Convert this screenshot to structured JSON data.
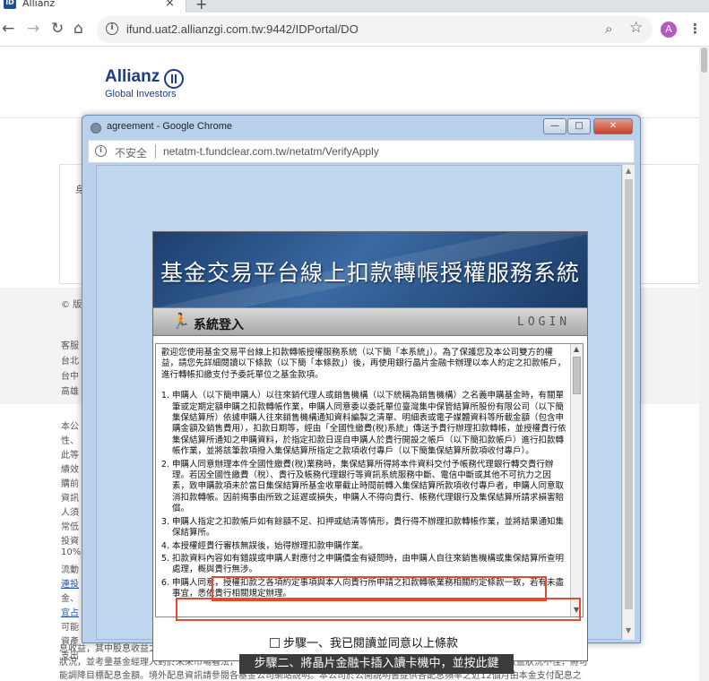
{
  "browser": {
    "tab_title": "Allianz",
    "tab_favicon": "ID",
    "address": "ifund.uat2.allianzgi.com.tw:9442/IDPortal/DO",
    "profile_initial": "A"
  },
  "page": {
    "logo_word": "Allianz",
    "logo_sub": "Global Investors",
    "fragments": [
      "身",
      "© 版",
      "客服",
      "台北",
      "台中",
      "高雄",
      "本公",
      "性、",
      "此等",
      "績效",
      "購前",
      "資訊",
      "人須",
      "常低",
      "投資",
      "10%",
      "流動",
      "金、",
      "可能",
      "資產",
      "支出"
    ],
    "links": [
      "連投",
      "宜占"
    ],
    "footnote_lines": [
      "息收益，其中股息收益之概況可由基金年化股息率而得；基金每月配息金額之決定，由境外基金機構根據已取得之資本利得及股息收益",
      "狀況，並考量基金經理人對於未來市場看法，評估預定之目標配息金額。若本基金因市場因素造成資本利得及股息收益狀況不佳，將可",
      "能調降目標配息金額。境外配息資訊請參閱各基金公司網站說明。本公司於公開說明書提供各配息頻率之近12個月由本金支付配息之"
    ]
  },
  "popup": {
    "window_title": "agreement - Google Chrome",
    "insecure_label": "不安全",
    "url": "netatm-t.fundclear.com.tw/netatm/VerifyApply",
    "banner_title": "基金交易平台線上扣款轉帳授權服務系統",
    "login_label": "系統登入",
    "login_en": "LOGIN",
    "terms_intro": "歡迎您使用基金交易平台線上扣款轉帳授權服務系統（以下簡「本系統」）。為了保護您及本公司雙方的權益，請您先詳細閱讀以下條款（以下簡「本條款」）後，再使用銀行晶片金融卡辦理以本人約定之扣款帳戶，進行轉帳扣繳支付予委託單位之基金款項。",
    "terms_items": [
      "申購人（以下簡申購人）以往來銷代理人或銷售機構（以下統稱為銷售機構）之名義申購基金時，有關單筆或定期定額申購之扣款轉帳作業，申購人同意委以委託單位臺灣集中保管結算所股份有限公司（以下簡集保結算所）依據申購人往來銷售機構通知資料編製之清單、明細表或電子媒體資料等所載金額（包含申購金額及銷售費用），扣款日期等，經由「全國性繳費(稅)系統」傳送予貴行辦理扣款轉帳，並授權貴行依集保結算所通知之申購資料，於指定扣款日逕自申購人於貴行開設之帳戶（以下簡扣款帳戶）進行扣款轉帳作業，並將該筆款項撥入集保結算所指定之款項收付專戶（以下簡集保結算所款項收付專戶）。",
      "申購人同意辦理本件全國性繳費(稅)業務時，集保結算所得將本件資料交付予帳務代理銀行轉交貴行辦理。若因全國性繳費（稅）、貴行及帳務代理銀行等資訊系統服務中斷、電信中斷或其他不可抗力之因素，致申購款項未於當日集保結算所基金收單截止時間前轉入集保結算所款項收付專戶者，申購人同意取消扣款轉帳。因前揭事由所致之延遲或損失，申購人不得向貴行、帳務代理銀行及集保結算所請求損害賠償。",
      "申購人指定之扣款帳戶如有餘額不足、扣押或結清等情形，貴行得不辦理扣款轉帳作業，並將結果通知集保結算所。",
      "本授權經貴行審核無誤後，始得辦理扣款申購作業。",
      "扣款資料內容如有錯誤或申購人對應付之申購價金有疑問時，由申購人自往來銷售機構或集保結算所查明處理，概與貴行無涉。",
      "申購人同意，授權扣款之各項約定事項與本人向貴行所申請之扣款轉帳業務相關約定條款一致，若有未盡事宜，悉依貴行相關規定辦理。"
    ],
    "step1_label": "步驟一、我已閱讀並同意以上條款",
    "step2_label": "步驟二、將晶片金融卡插入讀卡機中，並按此鍵"
  },
  "icons": {
    "back": "arrow-left-icon",
    "forward": "arrow-right-icon",
    "reload": "reload-icon",
    "home": "home-icon",
    "info": "info-icon",
    "zoom": "zoom-icon",
    "star": "star-icon",
    "menu": "kebab-menu-icon",
    "login": "running-figure-icon"
  },
  "colors": {
    "highlight": "#e8492c",
    "popup_frame": "#b9d1ea",
    "banner": "#2a5289",
    "brand": "#1b3c87"
  }
}
